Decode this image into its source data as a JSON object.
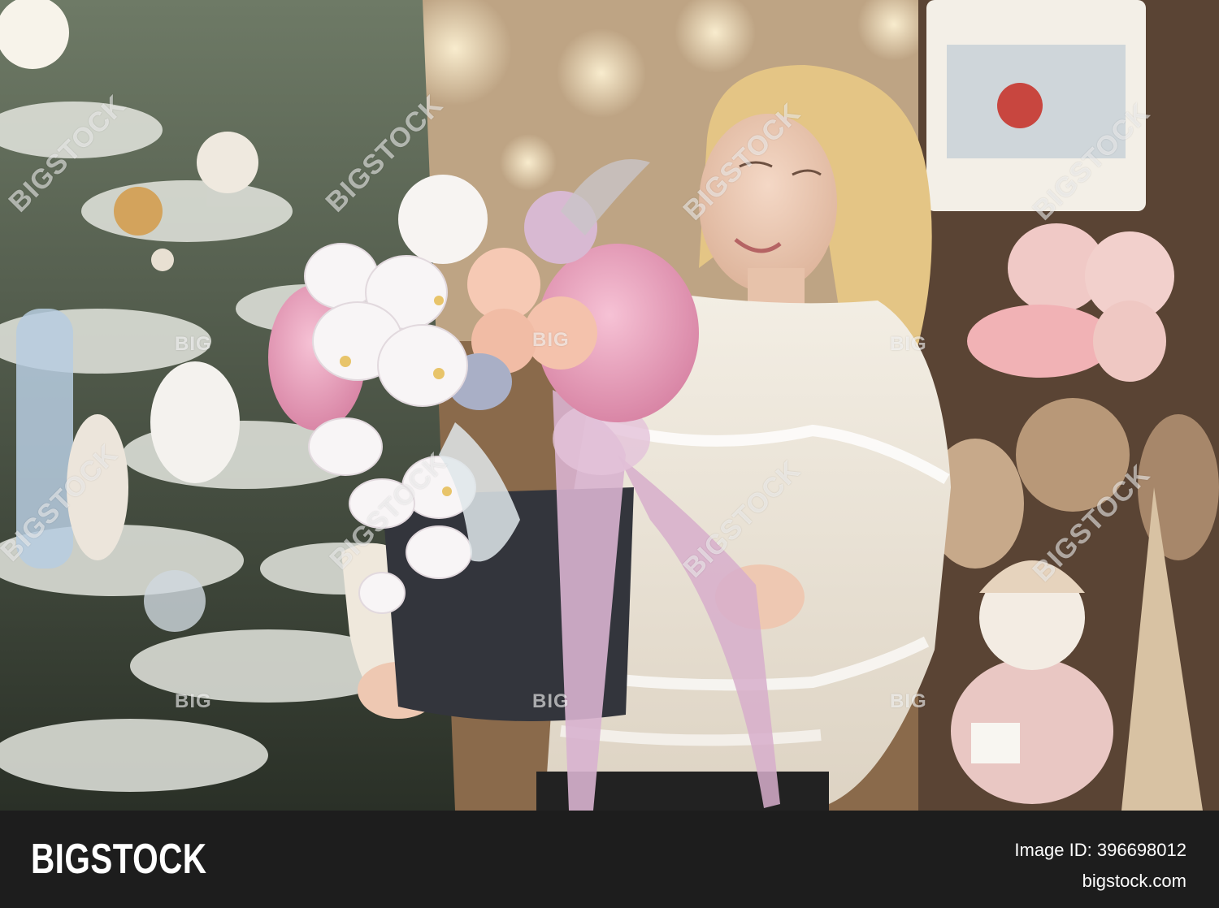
{
  "photo": {
    "watermark_text": "BIGSTOCK",
    "watermark_short": "BIG",
    "palette": {
      "background_warm": "#c9a47a",
      "sweater": "#efe8dc",
      "hair": "#e8c98a",
      "hydrangea_pink": "#eaa2bc",
      "orchid_white": "#f6f3f4",
      "rose_peach": "#f4c5ad",
      "hatbox": "#33353c",
      "ribbon": "#d8b2cf",
      "tree_frost": "#dfe2dc"
    }
  },
  "footer": {
    "brand": "BIGSTOCK",
    "image_id_label": "Image ID:",
    "image_id_value": "396698012",
    "site": "bigstock.com"
  }
}
